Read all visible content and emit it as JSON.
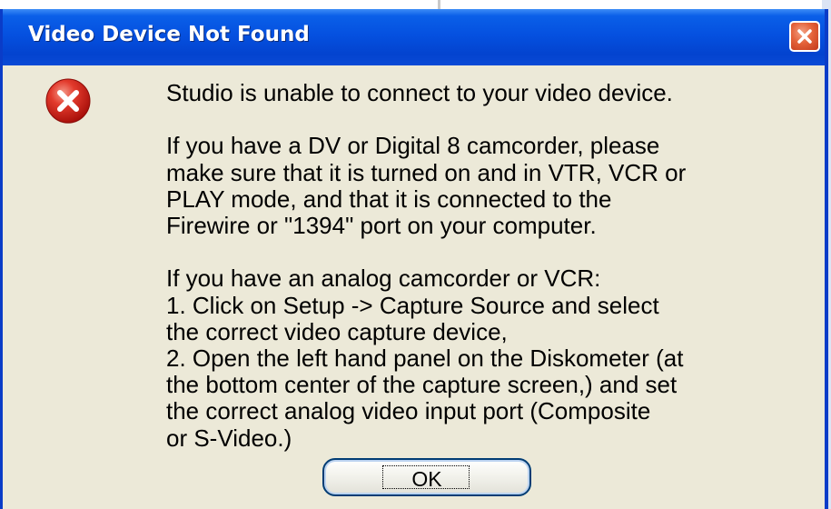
{
  "dialog": {
    "title": "Video Device Not Found",
    "close_icon": "close-icon",
    "status_icon": "error-icon",
    "message": {
      "line_1": "Studio is unable to connect to your video device.",
      "paragraph_2": [
        "If you have a DV or Digital 8 camcorder, please",
        "make sure that it is turned on and in VTR, VCR or",
        "PLAY mode, and that it is connected to the",
        "Firewire or \"1394\" port on your computer."
      ],
      "paragraph_3": [
        "If you have an analog camcorder or VCR:",
        "1. Click on Setup -> Capture Source and select",
        "the correct video capture device,",
        "2. Open the left hand panel on the Diskometer (at",
        "the bottom center of the capture screen,) and set",
        "the correct analog video input port (Composite",
        "or S-Video.)"
      ]
    },
    "ok_button": "OK"
  },
  "colors": {
    "title_bar": "#0551e0",
    "dialog_face": "#ece9d8",
    "close_button": "#e4623a",
    "error_icon": "#d1211a"
  }
}
